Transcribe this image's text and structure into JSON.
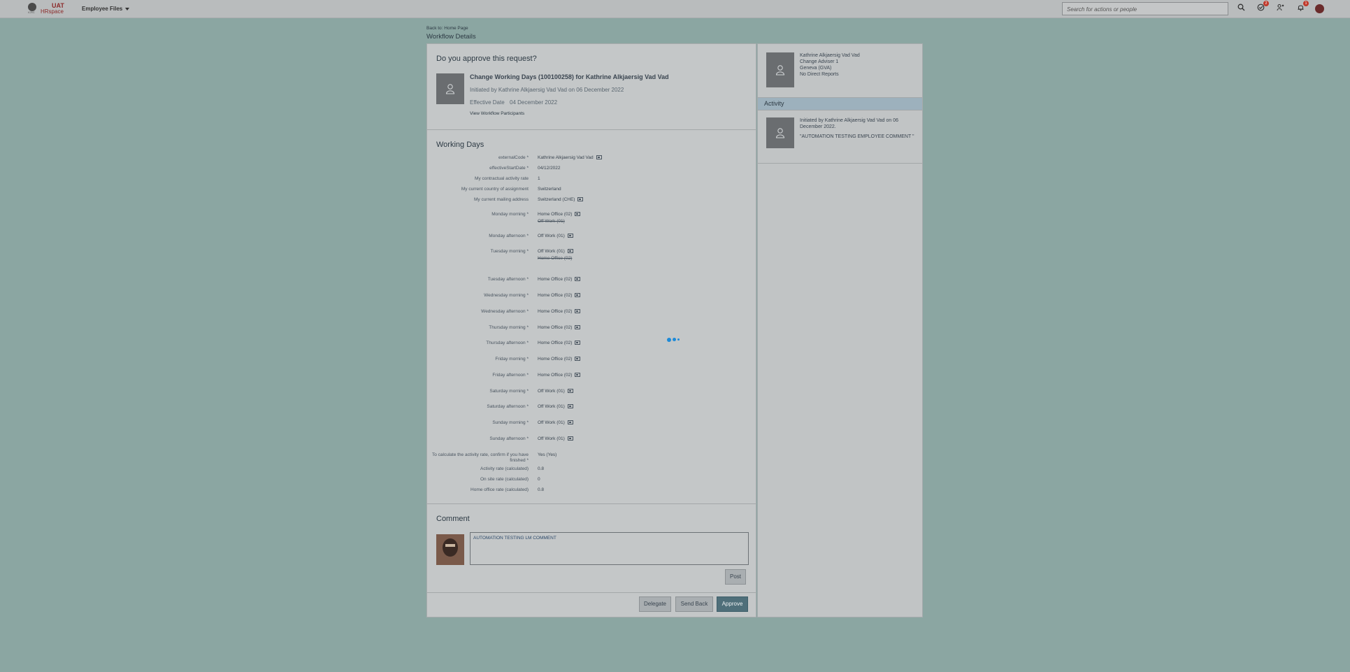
{
  "shell": {
    "logo_sub": "ICRC",
    "logo_uat": "UAT",
    "logo_hr": "HRspace",
    "module": "Employee Files",
    "search_placeholder": "Search for actions or people",
    "badges": {
      "todo": "2",
      "notifications": "1"
    },
    "icons": [
      "search-icon",
      "todo-icon",
      "people-icon",
      "bell-icon"
    ]
  },
  "header": {
    "back_link": "Back to: Home Page",
    "title": "Workflow Details"
  },
  "request": {
    "question": "Do you approve this request?",
    "title": "Change Working Days (100100258) for Kathrine Alkjaersig Vad Vad",
    "initiated": "Initiated by Kathrine Alkjaersig Vad Vad on 06 December 2022",
    "effective_label": "Effective Date",
    "effective_value": "04 December 2022",
    "participants_link": "View Workflow Participants"
  },
  "working_days": {
    "title": "Working Days",
    "fields": [
      {
        "label": "externalCode *",
        "value": "Kathrine Alkjaersig Vad Vad",
        "flag": true
      },
      {
        "label": "effectiveStartDate *",
        "value": "04/12/2022"
      },
      {
        "label": "My contractual activity rate",
        "value": "1"
      },
      {
        "label": "My current country of assignment",
        "value": "Switzerland"
      },
      {
        "label": "My current mailing address",
        "value": "Switzerland (CHE)",
        "flag": true
      },
      {
        "label": "Monday morning *",
        "value": "Home Office (02)",
        "flag": true,
        "old": "Off Work (01)"
      },
      {
        "label": "Monday afternoon *",
        "value": "Off Work (01)",
        "flag": true
      },
      {
        "label": "Tuesday morning *",
        "value": "Off Work (01)",
        "flag": true,
        "old": "Home Office (02)"
      },
      {
        "label": "Tuesday afternoon *",
        "value": "Home Office (02)",
        "flag": true
      },
      {
        "label": "Wednesday morning *",
        "value": "Home Office (02)",
        "flag": true
      },
      {
        "label": "Wednesday afternoon *",
        "value": "Home Office (02)",
        "flag": true
      },
      {
        "label": "Thursday morning *",
        "value": "Home Office (02)",
        "flag": true
      },
      {
        "label": "Thursday afternoon *",
        "value": "Home Office (02)",
        "flag": true
      },
      {
        "label": "Friday morning *",
        "value": "Home Office (02)",
        "flag": true
      },
      {
        "label": "Friday afternoon *",
        "value": "Home Office (02)",
        "flag": true
      },
      {
        "label": "Saturday morning *",
        "value": "Off Work (01)",
        "flag": true
      },
      {
        "label": "Saturday afternoon *",
        "value": "Off Work (01)",
        "flag": true
      },
      {
        "label": "Sunday morning *",
        "value": "Off Work (01)",
        "flag": true
      },
      {
        "label": "Sunday afternoon *",
        "value": "Off Work (01)",
        "flag": true
      },
      {
        "label": "To calculate the activity rate, confirm if you have finished *",
        "value": "Yes (Yes)"
      },
      {
        "label": "Activity rate (calculated)",
        "value": "0.8"
      },
      {
        "label": "On site rate (calculated)",
        "value": "0"
      },
      {
        "label": "Home office rate (calculated)",
        "value": "0.8"
      }
    ]
  },
  "comment": {
    "title": "Comment",
    "text": "AUTOMATION TESTING LM COMMENT",
    "post_label": "Post"
  },
  "actions": {
    "delegate": "Delegate",
    "send_back": "Send Back",
    "approve": "Approve"
  },
  "side": {
    "name": "Kathrine Alkjaersig Vad Vad",
    "role": "Change Adviser 1",
    "location": "Geneva (GVA)",
    "reports": "No Direct Reports",
    "activity_title": "Activity",
    "activity_text": "Initiated by Kathrine Alkjaersig Vad Vad on 06 December 2022.",
    "activity_comment": "\"AUTOMATION TESTING EMPLOYEE COMMENT \""
  }
}
